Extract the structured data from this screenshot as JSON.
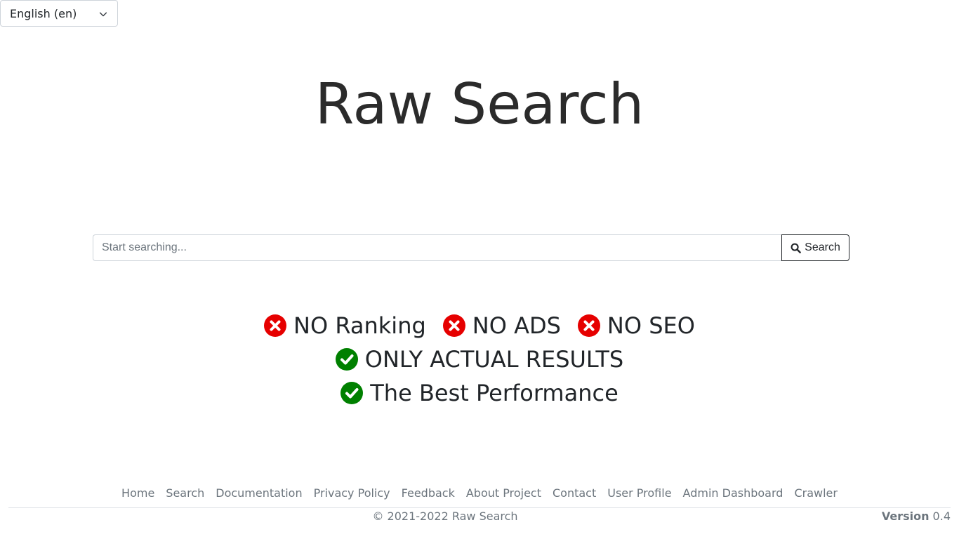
{
  "language": {
    "selected": "English (en)"
  },
  "brand": {
    "title": "Raw Search"
  },
  "search": {
    "placeholder": "Start searching...",
    "value": "",
    "button_label": "Search"
  },
  "features": [
    {
      "text": "NO Ranking",
      "status": "no",
      "icon": "cross-circle-icon",
      "color": "#e60000"
    },
    {
      "text": "NO ADS",
      "status": "no",
      "icon": "cross-circle-icon",
      "color": "#e60000"
    },
    {
      "text": "NO SEO",
      "status": "no",
      "icon": "cross-circle-icon",
      "color": "#e60000"
    },
    {
      "text": "ONLY ACTUAL RESULTS",
      "status": "yes",
      "icon": "check-circle-icon",
      "color": "#008000"
    },
    {
      "text": "The Best Performance",
      "status": "yes",
      "icon": "check-circle-icon",
      "color": "#008000"
    }
  ],
  "footer": {
    "links": [
      "Home",
      "Search",
      "Documentation",
      "Privacy Policy",
      "Feedback",
      "About Project",
      "Contact",
      "User Profile",
      "Admin Dashboard",
      "Crawler"
    ],
    "copyright": "© 2021-2022 Raw Search",
    "version_label": "Version",
    "version_number": "0.4"
  }
}
